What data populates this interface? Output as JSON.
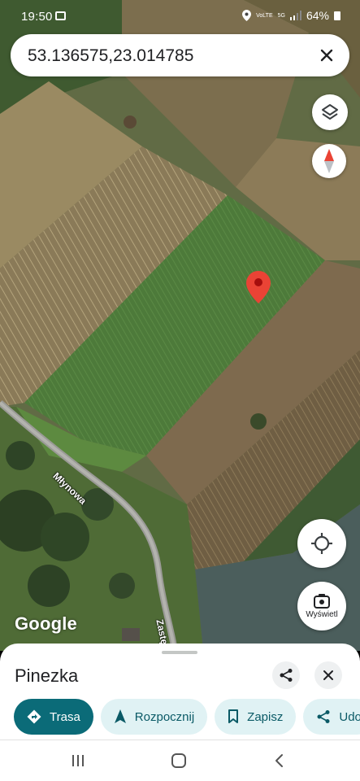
{
  "status_bar": {
    "time": "19:50",
    "network_top": "VoLTE",
    "network_5g": "5G",
    "battery": "64%"
  },
  "search": {
    "query": "53.136575,23.014785"
  },
  "map": {
    "street_1": "Młynowa",
    "street_2": "Zastę",
    "logo": "Google",
    "streetview_label": "Wyświetl"
  },
  "sheet": {
    "title": "Pinezka",
    "chips": [
      {
        "label": "Trasa",
        "icon": "directions-icon"
      },
      {
        "label": "Rozpocznij",
        "icon": "navigation-arrow-icon"
      },
      {
        "label": "Zapisz",
        "icon": "bookmark-icon"
      },
      {
        "label": "Udo",
        "icon": "share-icon"
      }
    ]
  },
  "colors": {
    "accent": "#0b6b78",
    "chip_bg": "#e0f2f4",
    "pin": "#ea4335"
  }
}
